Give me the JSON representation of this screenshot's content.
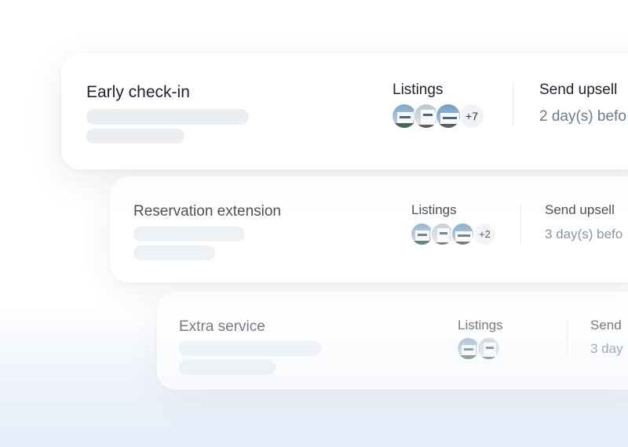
{
  "rules": [
    {
      "title": "Early check-in",
      "listings_label": "Listings",
      "more_count": "+7",
      "send_label": "Send upsell",
      "send_value": "2 day(s) befo"
    },
    {
      "title": "Reservation extension",
      "listings_label": "Listings",
      "more_count": "+2",
      "send_label": "Send upsell",
      "send_value": "3 day(s) befo"
    },
    {
      "title": "Extra service",
      "listings_label": "Listings",
      "send_label": "Send",
      "send_value": "3 day"
    }
  ],
  "colors": {
    "title_text": "#1d2330",
    "muted_text": "#6b7a8c",
    "skeleton_bar": "#eceff2",
    "background_bottom": "#e4edf9"
  }
}
